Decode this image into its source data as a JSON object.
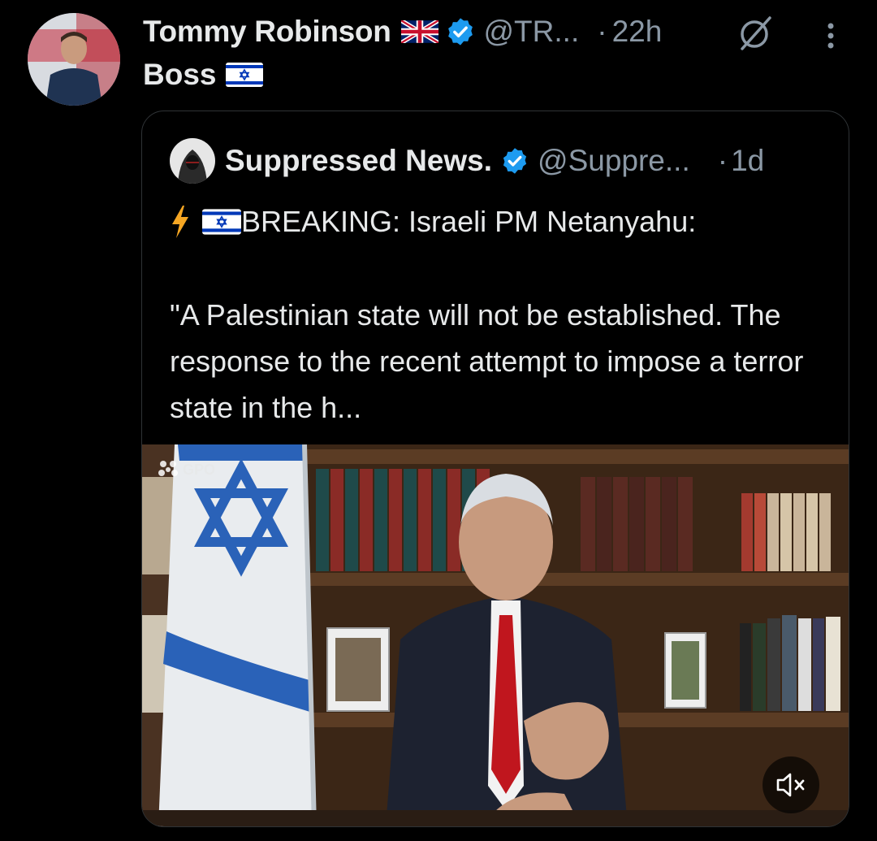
{
  "tweet": {
    "author_name": "Tommy Robinson",
    "author_handle": "@TR...",
    "separator": "·",
    "time": "22h",
    "text": "Boss",
    "icons": [
      "uk-flag-icon",
      "verified-badge-icon",
      "grok-icon",
      "more-options-icon",
      "israel-flag-icon"
    ]
  },
  "quote": {
    "author_name": "Suppressed News.",
    "author_handle": "@Suppre...",
    "separator": "·",
    "time": "1d",
    "headline": "BREAKING: Israeli PM Netanyahu:",
    "paragraph": "\"A Palestinian state will not be established. The response to the recent attempt to impose a terror state in the h...",
    "icons": [
      "lightning-icon",
      "israel-flag-icon",
      "verified-badge-icon"
    ],
    "video": {
      "watermark": "GPO",
      "icons": [
        "mute-icon"
      ]
    }
  },
  "colors": {
    "background": "#000000",
    "text_primary": "#e7e9ea",
    "text_secondary": "#8b98a5",
    "verified_blue": "#1d9bf0",
    "border": "#2f3336"
  }
}
